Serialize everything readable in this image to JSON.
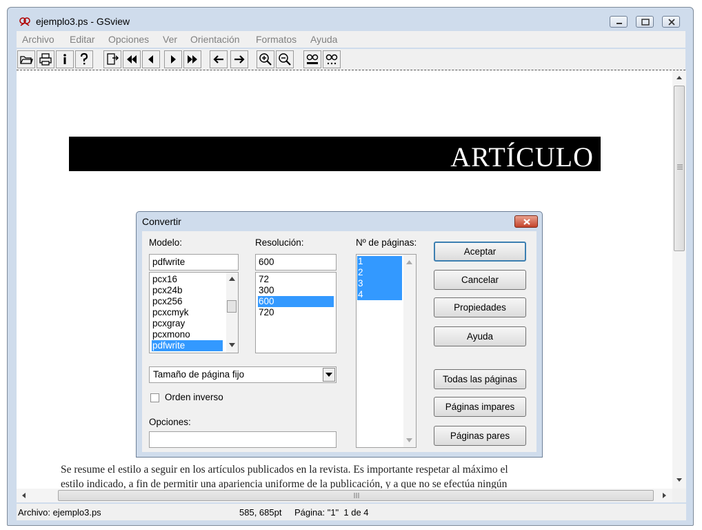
{
  "window": {
    "title": "ejemplo3.ps - GSview",
    "icon": "gsview-app-icon",
    "controls": [
      "minimize-icon",
      "maximize-icon",
      "close-icon"
    ]
  },
  "menu": [
    "Archivo",
    "Editar",
    "Opciones",
    "Ver",
    "Orientación",
    "Formatos",
    "Ayuda"
  ],
  "toolbar": [
    "open-icon",
    "print-icon",
    "info-icon",
    "help-icon",
    "goto-page-icon",
    "first-page-icon",
    "prev-page-icon",
    "next-page-icon",
    "last-page-icon",
    "back-icon",
    "forward-icon",
    "zoom-in-icon",
    "zoom-out-icon",
    "find-text-icon",
    "find-next-icon"
  ],
  "document": {
    "header": "ARTÍCULO",
    "paragraph_lines": [
      "Se resume el estilo a seguir en los artículos publicados en la revista. Es importante respetar al máximo el",
      "estilo indicado, a fin de permitir una apariencia uniforme de la publicación, y a que no se efectúa ningún"
    ]
  },
  "dialog": {
    "title": "Convertir",
    "model_label": "Modelo:",
    "model_value": "pdfwrite",
    "model_list": [
      "pcx16",
      "pcx24b",
      "pcx256",
      "pcxcmyk",
      "pcxgray",
      "pcxmono",
      "pdfwrite"
    ],
    "model_selected": "pdfwrite",
    "resolution_label": "Resolución:",
    "resolution_value": "600",
    "resolution_list": [
      "72",
      "300",
      "600",
      "720"
    ],
    "resolution_selected": "600",
    "pages_label": "Nº de páginas:",
    "pages_list": [
      "1",
      "2",
      "3",
      "4"
    ],
    "page_size_value": "Tamaño de página fijo",
    "reverse_order_label": "Orden inverso",
    "reverse_order_checked": false,
    "options_label": "Opciones:",
    "options_value": "",
    "buttons": {
      "accept": "Aceptar",
      "cancel": "Cancelar",
      "properties": "Propiedades",
      "help": "Ayuda",
      "all_pages": "Todas las páginas",
      "odd_pages": "Páginas impares",
      "even_pages": "Páginas pares"
    }
  },
  "statusbar": {
    "file": "Archivo: ejemplo3.ps",
    "coords": "585, 685pt",
    "page": "Página: \"1\"  1 de 4"
  }
}
